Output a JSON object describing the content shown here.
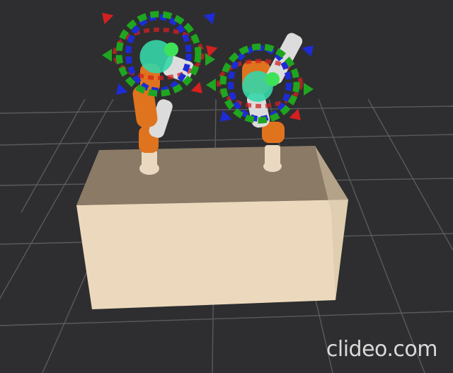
{
  "viewer": {
    "background_color": "#2e2e30",
    "grid_color": "#5a5a5c",
    "table_colors": {
      "top": "#8a7a66",
      "front": "#ecd9bd",
      "side": "#d7c5a6"
    },
    "robot_colors": {
      "orange": "#e0731e",
      "white": "#dcdcdc",
      "cream": "#ead9c0"
    },
    "marker_colors": {
      "x_axis": "#d42020",
      "y_axis": "#1fa51f",
      "z_axis": "#1d2bd6",
      "sphere": "#35d6a8"
    }
  },
  "watermark": {
    "text": "clideo.com"
  }
}
